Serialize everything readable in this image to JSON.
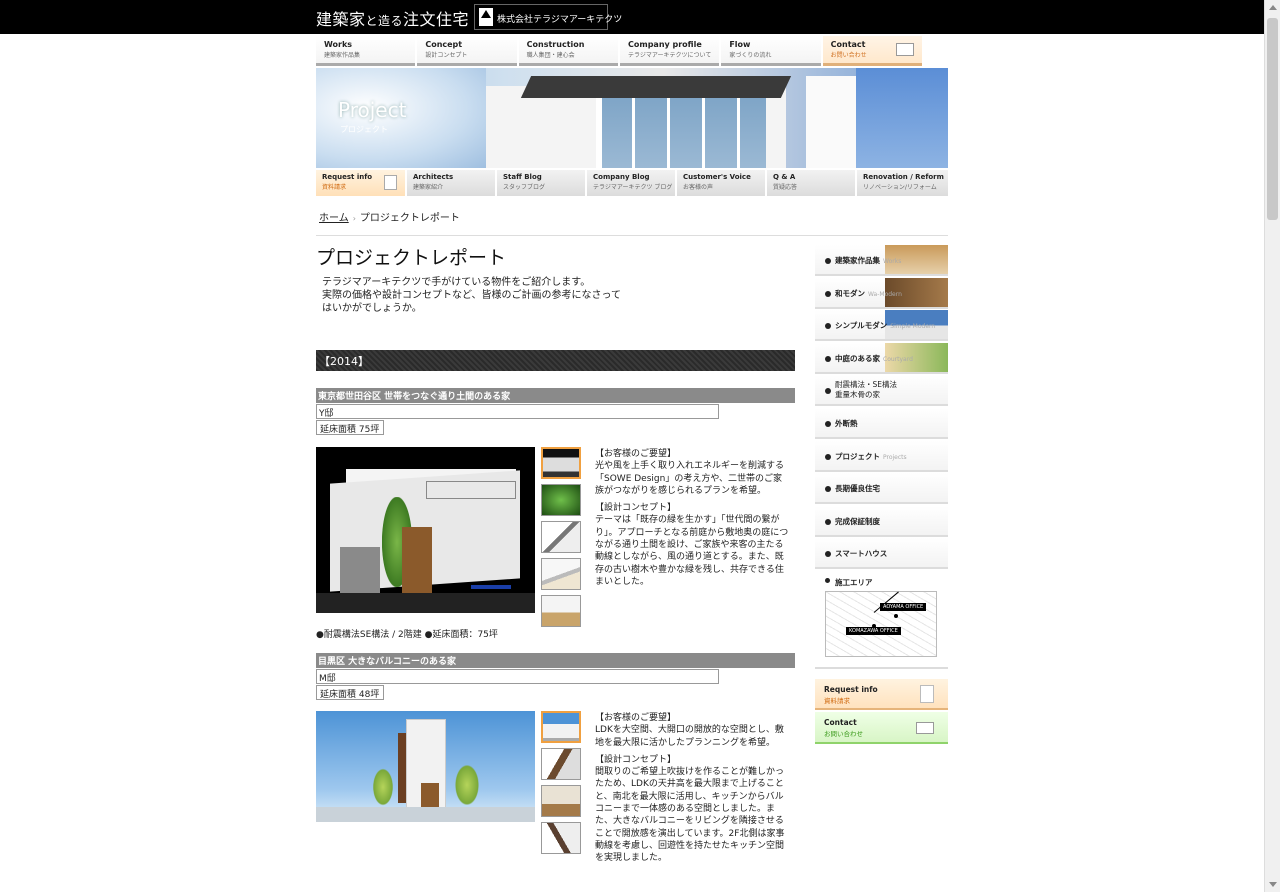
{
  "header": {
    "title_a": "建築家",
    "title_b": "と造る",
    "title_c": "注文住宅",
    "company": "株式会社テラジマアーキテクツ"
  },
  "global_nav": [
    {
      "en": "Works",
      "jp": "建築家作品集"
    },
    {
      "en": "Concept",
      "jp": "設計コンセプト"
    },
    {
      "en": "Construction",
      "jp": "職人集団・建心会"
    },
    {
      "en": "Company profile",
      "jp": "テラジマアーキテクツについて"
    },
    {
      "en": "Flow",
      "jp": "家づくりの流れ"
    },
    {
      "en": "Contact",
      "jp": "お問い合わせ"
    }
  ],
  "hero": {
    "label": "Project",
    "label_jp": "プロジェクト"
  },
  "sub_nav": [
    {
      "en": "Request info",
      "jp": "資料請求"
    },
    {
      "en": "Architects",
      "jp": "建築家紹介"
    },
    {
      "en": "Staff Blog",
      "jp": "スタッフブログ"
    },
    {
      "en": "Company Blog",
      "jp": "テラジマアーキテクツ ブログ"
    },
    {
      "en": "Customer's Voice",
      "jp": "お客様の声"
    },
    {
      "en": "Q & A",
      "jp": "質疑応答"
    },
    {
      "en": "Renovation / Reform",
      "jp": "リノベーション/リフォーム"
    }
  ],
  "breadcrumb": {
    "home": "ホーム",
    "sep": "›",
    "current": "プロジェクトレポート"
  },
  "page": {
    "title": "プロジェクトレポート",
    "lead_1": "テラジマアーキテクツで手がけている物件をご紹介します。",
    "lead_2": "実際の価格や設計コンセプトなど、皆様のご計画の参考になさって",
    "lead_3": "はいかがでしょうか。",
    "year": "【2014】"
  },
  "projects": [
    {
      "title": "東京都世田谷区 世帯をつなぐ通り土間のある家",
      "owner": "Y邸",
      "area": "延床面積 75坪",
      "request_heading": "【お客様のご要望】",
      "request_text": "光や風を上手く取り入れエネルギーを削減する「SOWE Design」の考え方や、二世帯のご家族がつながりを感じられるプランを希望。",
      "concept_heading": "【設計コンセプト】",
      "concept_text": "テーマは「既存の緑を生かす」「世代間の繋がり」。アプローチとなる前庭から敷地奥の庭につながる通り土間を設け、ご家族や来客の主たる動線としながら、風の通り道とする。また、既存の古い樹木や豊かな緑を残し、共存できる住まいとした。",
      "spec": "●耐震構法SE構法 / 2階建 ●延床面積：75坪"
    },
    {
      "title": "目黒区 大きなバルコニーのある家",
      "owner": "M邸",
      "area": "延床面積 48坪",
      "request_heading": "【お客様のご要望】",
      "request_text": "LDKを大空間、大開口の開放的な空間とし、敷地を最大限に活かしたプランニングを希望。",
      "concept_heading": "【設計コンセプト】",
      "concept_text": "間取りのご希望上吹抜けを作ることが難しかったため、LDKの天井高を最大限まで上げることと、南北を最大限に活用し、キッチンからバルコニーまで一体感のある空間としました。また、大きなバルコニーをリビングを隣接させることで開放感を演出しています。2F北側は家事動線を考慮し、回遊性を持たせたキッチン空間を実現しました。"
    }
  ],
  "sidebar": {
    "items": [
      {
        "label": "建築家作品集",
        "en": "Works"
      },
      {
        "label": "和モダン",
        "en": "Wa-Modern"
      },
      {
        "label": "シンプルモダン",
        "en": "Simple Modern"
      },
      {
        "label": "中庭のある家",
        "en": "Courtyard"
      },
      {
        "label": "耐震構法・SE構法",
        "label_2": "重量木骨の家"
      },
      {
        "label": "外断熱"
      },
      {
        "label": "プロジェクト",
        "en": "Projects"
      },
      {
        "label": "長期優良住宅"
      },
      {
        "label": "完成保証制度"
      },
      {
        "label": "スマートハウス"
      }
    ],
    "area_title": "施工エリア",
    "map_aoyama": "AOYAMA OFFICE",
    "map_komazawa": "KOMAZAWA OFFICE",
    "request_en": "Request info",
    "request_jp": "資料請求",
    "contact_en": "Contact",
    "contact_jp": "お問い合わせ"
  }
}
